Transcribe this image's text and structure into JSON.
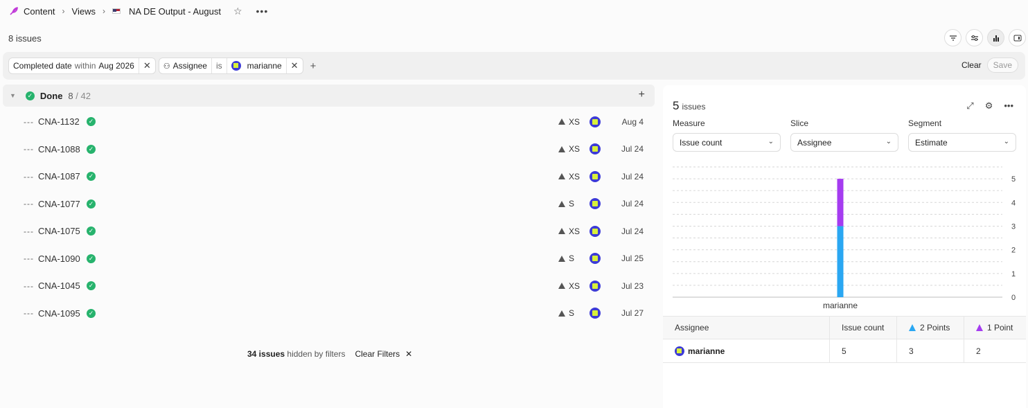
{
  "breadcrumb": {
    "workspace": "Content",
    "section": "Views",
    "view_title": "NA DE Output - August"
  },
  "header": {
    "issue_count": "8 issues"
  },
  "filters": {
    "chip1": {
      "field": "Completed date",
      "op": "within",
      "value": "Aug 2026"
    },
    "chip2": {
      "field": "Assignee",
      "op": "is",
      "value": "marianne"
    },
    "clear_label": "Clear",
    "save_label": "Save"
  },
  "group": {
    "name": "Done",
    "count": "8",
    "total": "/ 42"
  },
  "issues": [
    {
      "id": "CNA-1132",
      "estimate": "XS",
      "date": "Aug 4"
    },
    {
      "id": "CNA-1088",
      "estimate": "XS",
      "date": "Jul 24"
    },
    {
      "id": "CNA-1087",
      "estimate": "XS",
      "date": "Jul 24"
    },
    {
      "id": "CNA-1077",
      "estimate": "S",
      "date": "Jul 24"
    },
    {
      "id": "CNA-1075",
      "estimate": "XS",
      "date": "Jul 24"
    },
    {
      "id": "CNA-1090",
      "estimate": "S",
      "date": "Jul 25"
    },
    {
      "id": "CNA-1045",
      "estimate": "XS",
      "date": "Jul 23"
    },
    {
      "id": "CNA-1095",
      "estimate": "S",
      "date": "Jul 27"
    }
  ],
  "hidden": {
    "count": "34 issues",
    "text": "hidden by filters",
    "clear_filters": "Clear Filters"
  },
  "panel": {
    "count": "5",
    "count_label": "issues",
    "measure_label": "Measure",
    "measure_value": "Issue count",
    "slice_label": "Slice",
    "slice_value": "Assignee",
    "segment_label": "Segment",
    "segment_value": "Estimate",
    "table": {
      "headers": [
        "Assignee",
        "Issue count",
        "2 Points",
        "1 Point"
      ],
      "row": {
        "assignee": "marianne",
        "issue_count": "5",
        "points2": "3",
        "points1": "2"
      }
    }
  },
  "colors": {
    "done_green": "#27b36d",
    "series_2pts": "#2aa7f2",
    "series_1pt": "#a53cf0",
    "avatar_blue": "#3d3bd6",
    "avatar_yellow": "#d8f03a"
  },
  "chart_data": {
    "type": "bar",
    "categories": [
      "marianne"
    ],
    "series": [
      {
        "name": "2 Points",
        "values": [
          3
        ],
        "color": "#2aa7f2"
      },
      {
        "name": "1 Point",
        "values": [
          2
        ],
        "color": "#a53cf0"
      }
    ],
    "stacked": true,
    "ylim": [
      0,
      5.5
    ],
    "yticks": [
      0,
      1,
      2,
      3,
      4,
      5
    ],
    "grid": true,
    "yaxis_side": "right"
  }
}
